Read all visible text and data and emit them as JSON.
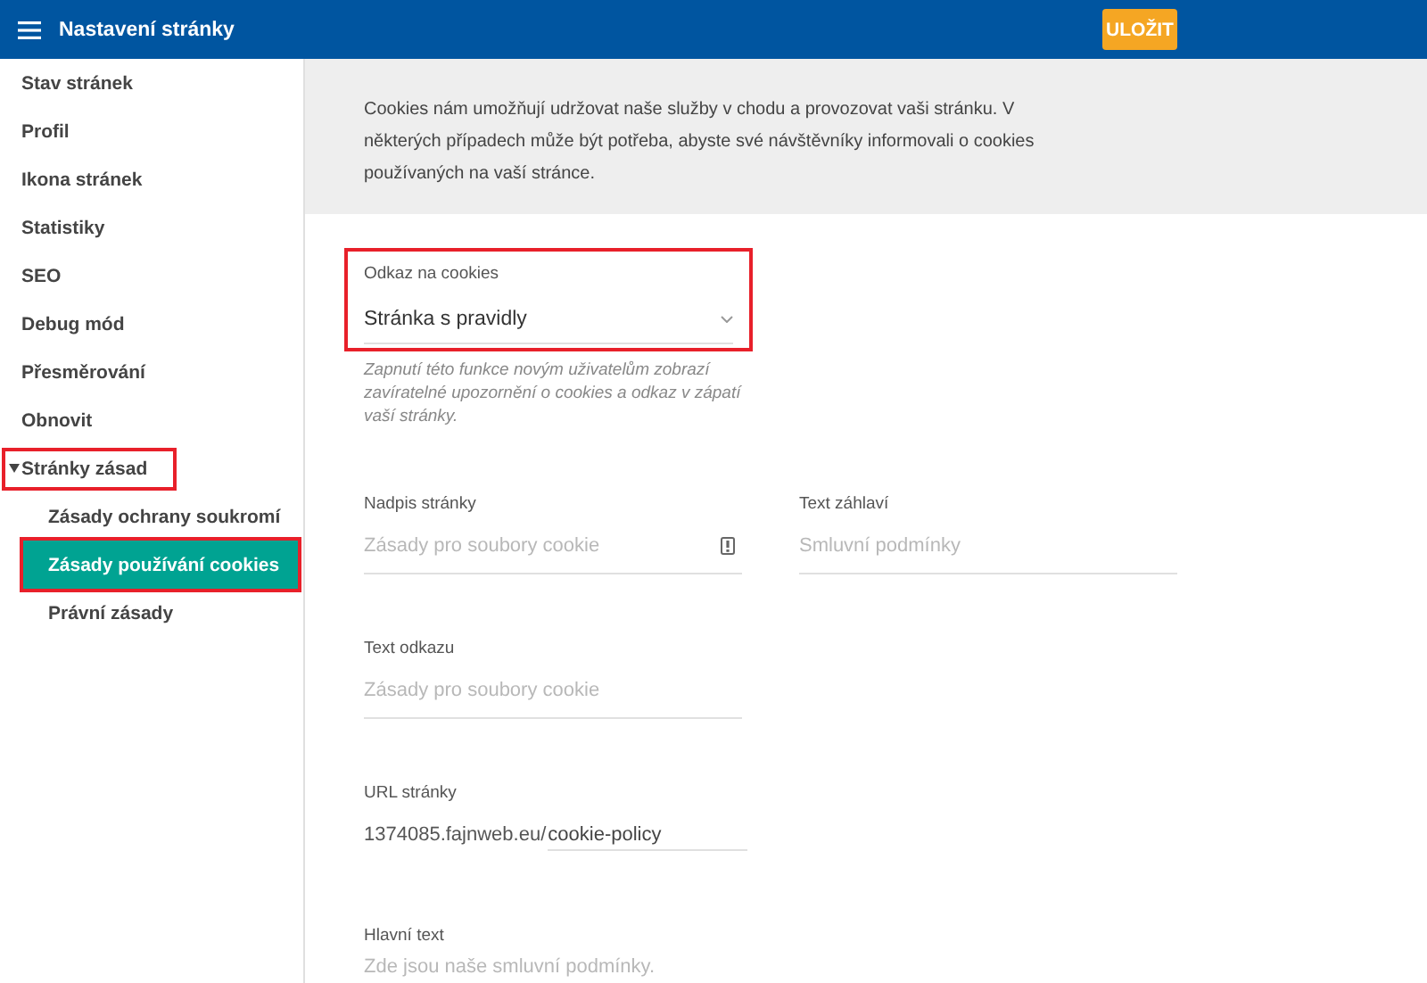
{
  "header": {
    "title": "Nastavení stránky",
    "save_button": "ULOŽIT"
  },
  "sidebar": {
    "items": [
      {
        "label": "Stav stránek",
        "selected": false,
        "highlighted": false
      },
      {
        "label": "Profil",
        "selected": false,
        "highlighted": false
      },
      {
        "label": "Ikona stránek",
        "selected": false,
        "highlighted": false
      },
      {
        "label": "Statistiky",
        "selected": false,
        "highlighted": false
      },
      {
        "label": "SEO",
        "selected": false,
        "highlighted": false
      },
      {
        "label": "Debug mód",
        "selected": false,
        "highlighted": false
      },
      {
        "label": "Přesměrování",
        "selected": false,
        "highlighted": false
      },
      {
        "label": "Obnovit",
        "selected": false,
        "highlighted": false
      },
      {
        "label": "Stránky zásad",
        "selected": false,
        "highlighted": true,
        "expanded": true,
        "children": [
          {
            "label": "Zásady ochrany soukromí",
            "selected": false,
            "highlighted": false
          },
          {
            "label": "Zásady používání cookies",
            "selected": true,
            "highlighted": true
          },
          {
            "label": "Právní zásady",
            "selected": false,
            "highlighted": false
          }
        ]
      }
    ]
  },
  "intro": "Cookies nám umožňují udržovat naše služby v chodu a provozovat vaši stránku. V některých případech může být potřeba, abyste své návštěvníky informovali o cookies používaných na vaší stránce.",
  "cookie_link": {
    "label": "Odkaz na cookies",
    "value": "Stránka s pravidly",
    "highlighted": true,
    "hint": "Zapnutí této funkce novým uživatelům zobrazí zavíratelné upozornění o cookies a odkaz v zápatí vaší stránky."
  },
  "field_rows": [
    [
      {
        "kind": "text",
        "label": "Nadpis stránky",
        "placeholder": "Zásady pro soubory cookie",
        "icon": true
      },
      {
        "kind": "text",
        "label": "Text záhlaví",
        "placeholder": "Smluvní podmínky"
      }
    ],
    [
      {
        "kind": "text",
        "label": "Text odkazu",
        "placeholder": "Zásady pro soubory cookie"
      }
    ],
    [
      {
        "kind": "url",
        "label": "URL stránky",
        "prefix": "1374085.fajnweb.eu/",
        "value": "cookie-policy"
      }
    ],
    [
      {
        "kind": "textarea",
        "label": "Hlavní text",
        "placeholder": "Zde jsou naše smluvní podmínky."
      }
    ]
  ]
}
